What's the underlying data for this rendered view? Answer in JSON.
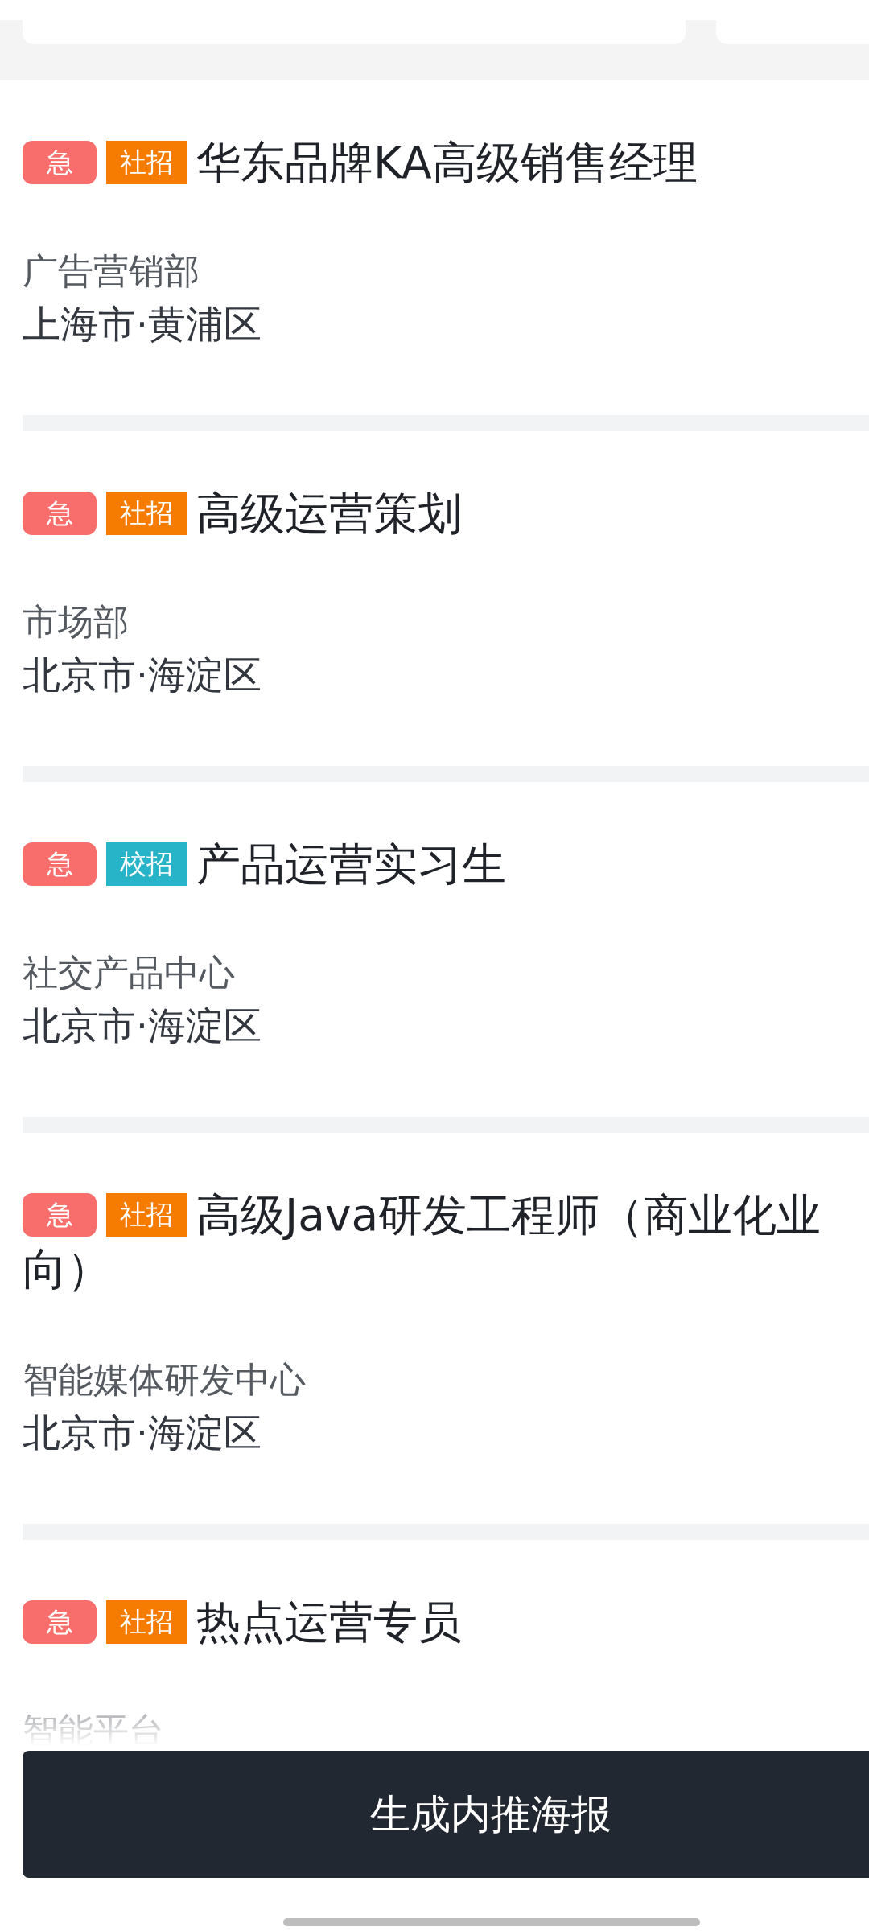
{
  "jobs": [
    {
      "tags": [
        {
          "kind": "urgent",
          "text": "急"
        },
        {
          "kind": "social",
          "text": "社招"
        }
      ],
      "title_lines": [
        "华东品牌KA高级销售经理"
      ],
      "department": "广告营销部",
      "location": "上海市·黄浦区"
    },
    {
      "tags": [
        {
          "kind": "urgent",
          "text": "急"
        },
        {
          "kind": "social",
          "text": "社招"
        }
      ],
      "title_lines": [
        "高级运营策划"
      ],
      "department": "市场部",
      "location": "北京市·海淀区"
    },
    {
      "tags": [
        {
          "kind": "urgent",
          "text": "急"
        },
        {
          "kind": "campus",
          "text": "校招"
        }
      ],
      "title_lines": [
        "产品运营实习生"
      ],
      "department": "社交产品中心",
      "location": "北京市·海淀区"
    },
    {
      "tags": [
        {
          "kind": "urgent",
          "text": "急"
        },
        {
          "kind": "social",
          "text": "社招"
        }
      ],
      "title_lines": [
        "高级Java研发工程师（商业化业",
        "向）"
      ],
      "department": "智能媒体研发中心",
      "location": "北京市·海淀区"
    },
    {
      "tags": [
        {
          "kind": "urgent",
          "text": "急"
        },
        {
          "kind": "social",
          "text": "社招"
        }
      ],
      "title_lines": [
        "热点运营专员"
      ],
      "department": "智能平台"
    }
  ],
  "footer": {
    "button": "生成内推海报"
  }
}
